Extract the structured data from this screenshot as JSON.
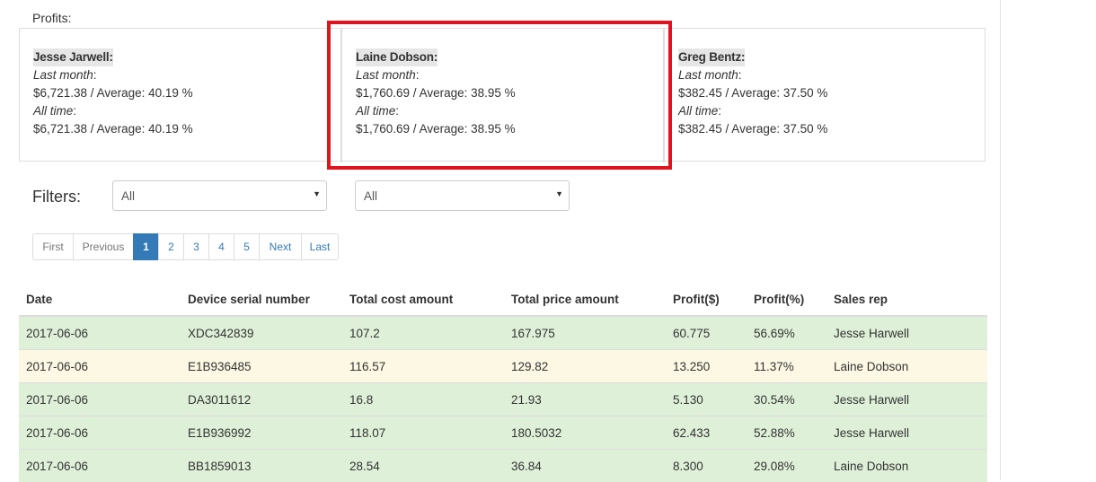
{
  "profits": {
    "label": "Profits:",
    "reps": [
      {
        "name": "Jesse Jarwell:",
        "last_month_label": "Last month",
        "last_month_value": "$6,721.38 / Average: 40.19 %",
        "all_time_label": "All time",
        "all_time_value": "$6,721.38 / Average: 40.19 %"
      },
      {
        "name": "Laine Dobson:",
        "last_month_label": "Last month",
        "last_month_value": "$1,760.69 / Average: 38.95 %",
        "all_time_label": "All time",
        "all_time_value": "$1,760.69 / Average: 38.95 %"
      },
      {
        "name": "Greg Bentz:",
        "last_month_label": "Last month",
        "last_month_value": "$382.45 / Average: 37.50 %",
        "all_time_label": "All time",
        "all_time_value": "$382.45 / Average: 37.50 %"
      }
    ]
  },
  "filters": {
    "label": "Filters:",
    "select1_value": "All",
    "select2_value": "All",
    "caret": "▼"
  },
  "pagination": {
    "first": "First",
    "previous": "Previous",
    "pages": [
      "1",
      "2",
      "3",
      "4",
      "5"
    ],
    "active_page": "1",
    "next": "Next",
    "last": "Last"
  },
  "table": {
    "headers": [
      "Date",
      "Device serial number",
      "Total cost amount",
      "Total price amount",
      "Profit($)",
      "Profit(%)",
      "Sales rep"
    ],
    "rows": [
      [
        "2017-06-06",
        "XDC342839",
        "107.2",
        "167.975",
        "60.775",
        "56.69%",
        "Jesse Harwell"
      ],
      [
        "2017-06-06",
        "E1B936485",
        "116.57",
        "129.82",
        "13.250",
        "11.37%",
        "Laine Dobson"
      ],
      [
        "2017-06-06",
        "DA3011612",
        "16.8",
        "21.93",
        "5.130",
        "30.54%",
        "Jesse Harwell"
      ],
      [
        "2017-06-06",
        "E1B936992",
        "118.07",
        "180.5032",
        "62.433",
        "52.88%",
        "Jesse Harwell"
      ],
      [
        "2017-06-06",
        "BB1859013",
        "28.54",
        "36.84",
        "8.300",
        "29.08%",
        "Laine Dobson"
      ]
    ],
    "row_styles": [
      "success",
      "warning",
      "success",
      "success",
      "success"
    ]
  },
  "colors": {
    "success_row": "#dff0d8",
    "warning_row": "#fcf8e3",
    "highlight": "#e0141e",
    "active_page": "#337ab7"
  }
}
